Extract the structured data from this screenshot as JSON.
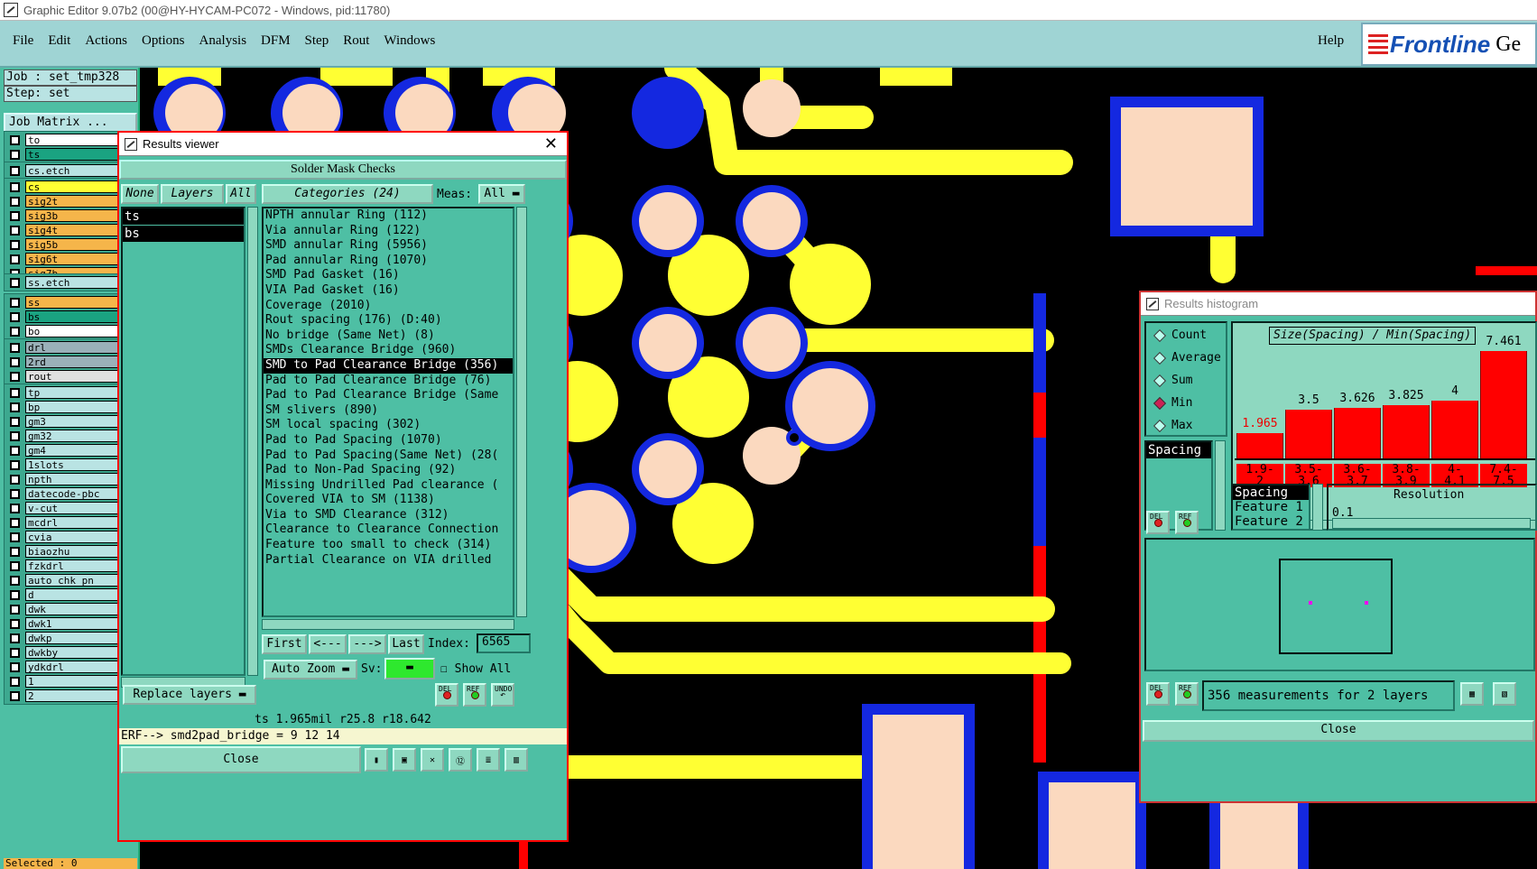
{
  "title_bar": "Graphic Editor 9.07b2 (00@HY-HYCAM-PC072 - Windows, pid:11780)",
  "menu": [
    "File",
    "Edit",
    "Actions",
    "Options",
    "Analysis",
    "DFM",
    "Step",
    "Rout",
    "Windows"
  ],
  "help": "Help",
  "logo": {
    "brand": "Frontline",
    "brand_suffix": "Ge"
  },
  "job_label": "Job : set_tmp328",
  "step_label": "Step: set",
  "job_matrix": "Job Matrix ...",
  "layers": [
    {
      "name": "to",
      "color": "#ffffff",
      "sel": true
    },
    {
      "name": "ts",
      "color": "#1aa381",
      "sel": true
    },
    {
      "name": "cs.etch",
      "color": "#b9e3e3",
      "sel": false
    },
    {
      "name": "cs",
      "color": "#ffff33",
      "sel": true
    },
    {
      "name": "sig2t",
      "color": "#f5b54a",
      "sel": false
    },
    {
      "name": "sig3b",
      "color": "#f5b54a",
      "sel": true
    },
    {
      "name": "sig4t",
      "color": "#f5b54a",
      "sel": true
    },
    {
      "name": "sig5b",
      "color": "#f5b54a",
      "sel": false
    },
    {
      "name": "sig6t",
      "color": "#f5b54a",
      "sel": false
    },
    {
      "name": "sig7b",
      "color": "#f5b54a",
      "sel": false
    },
    {
      "name": "ss.etch",
      "color": "#b9e3e3",
      "sel": false
    },
    {
      "name": "ss",
      "color": "#f5b54a",
      "sel": false
    },
    {
      "name": "bs",
      "color": "#1aa381",
      "sel": false
    },
    {
      "name": "bo",
      "color": "#ffffff",
      "sel": true
    },
    {
      "name": "drl",
      "color": "#9ab0b8",
      "sel": false
    },
    {
      "name": "2rd",
      "color": "#9ab0b8",
      "sel": false
    },
    {
      "name": "rout",
      "color": "#e0e0e0",
      "sel": false
    },
    {
      "name": "tp",
      "color": "#b9e3e3",
      "sel": true
    },
    {
      "name": "bp",
      "color": "#b9e3e3",
      "sel": false
    },
    {
      "name": "gm3",
      "color": "#b9e3e3",
      "sel": false
    },
    {
      "name": "gm32",
      "color": "#b9e3e3",
      "sel": false
    },
    {
      "name": "gm4",
      "color": "#b9e3e3",
      "sel": false
    },
    {
      "name": "1slots",
      "color": "#b9e3e3",
      "sel": false
    },
    {
      "name": "npth",
      "color": "#b9e3e3",
      "sel": false
    },
    {
      "name": "datecode-pbc",
      "color": "#b9e3e3",
      "sel": false
    },
    {
      "name": "v-cut",
      "color": "#b9e3e3",
      "sel": false
    },
    {
      "name": "mcdrl",
      "color": "#b9e3e3",
      "sel": false
    },
    {
      "name": "cvia",
      "color": "#b9e3e3",
      "sel": false
    },
    {
      "name": "biaozhu",
      "color": "#b9e3e3",
      "sel": false
    },
    {
      "name": "fzkdrl",
      "color": "#b9e3e3",
      "sel": false
    },
    {
      "name": "auto_chk_pn",
      "color": "#b9e3e3",
      "sel": false
    },
    {
      "name": "d",
      "color": "#b9e3e3",
      "sel": false
    },
    {
      "name": "dwk",
      "color": "#b9e3e3",
      "sel": false
    },
    {
      "name": "dwk1",
      "color": "#b9e3e3",
      "sel": false
    },
    {
      "name": "dwkp",
      "color": "#b9e3e3",
      "sel": false
    },
    {
      "name": "dwkby",
      "color": "#b9e3e3",
      "sel": false
    },
    {
      "name": "ydkdrl",
      "color": "#b9e3e3",
      "sel": false
    },
    {
      "name": "1",
      "color": "#b9e3e3",
      "sel": false
    },
    {
      "name": "2",
      "color": "#b9e3e3",
      "sel": false
    }
  ],
  "selected": "Selected : 0",
  "results_viewer": {
    "title": "Results viewer",
    "header": "Solder Mask Checks",
    "none": "None",
    "layers_btn": "Layers",
    "all_btn": "All",
    "categories_btn": "Categories (24)",
    "meas_label": "Meas:",
    "meas_value": "All",
    "layer_list": [
      "ts",
      "bs"
    ],
    "categories": [
      "NPTH annular Ring (112)",
      "Via annular Ring (122)",
      "SMD annular Ring (5956)",
      "Pad annular Ring (1070)",
      "SMD Pad Gasket (16)",
      "VIA Pad Gasket (16)",
      "Coverage (2010)",
      "Rout spacing (176)       (D:40)",
      "No bridge (Same Net) (8)",
      "SMDs Clearance Bridge (960)",
      "SMD to Pad Clearance Bridge (356)",
      "Pad to Pad Clearance Bridge (76)",
      "Pad to Pad Clearance Bridge (Same",
      "SM slivers (890)",
      "SM local spacing (302)",
      "Pad to Pad Spacing (1070)",
      "Pad to Pad Spacing(Same Net) (28(",
      "Pad to Non-Pad Spacing (92)",
      "Missing Undrilled Pad clearance (",
      "Covered VIA to SM (1138)",
      "Via to SMD Clearance (312)",
      "Clearance to Clearance Connection",
      "Feature too small to check (314)",
      "Partial Clearance on VIA drilled"
    ],
    "selected_category_index": 10,
    "nav": {
      "first": "First",
      "prev": "<---",
      "next": "--->",
      "last": "Last",
      "index_label": "Index:",
      "index_value": "6565"
    },
    "auto_zoom": "Auto Zoom",
    "sv_label": "Sv:",
    "show_all": "Show All",
    "replace_layers": "Replace layers",
    "del": "DEL",
    "ref": "REF",
    "undo": "UNDO",
    "status": "ts 1.965mil  r25.8  r18.642",
    "erf": "ERF--> smd2pad_bridge = 9 12 14",
    "close": "Close"
  },
  "histogram": {
    "title": "Results histogram",
    "modes": [
      {
        "label": "Count",
        "on": false
      },
      {
        "label": "Average",
        "on": false
      },
      {
        "label": "Sum",
        "on": false
      },
      {
        "label": "Min",
        "on": true
      },
      {
        "label": "Max",
        "on": false
      }
    ],
    "chart_title": "Size(Spacing) / Min(Spacing)",
    "bars": [
      {
        "value": "1.965",
        "bin": [
          "1.9-",
          "2"
        ],
        "level": 0.22,
        "red": true
      },
      {
        "value": "3.5",
        "bin": [
          "3.5-",
          "3.6"
        ],
        "level": 0.42,
        "red": false
      },
      {
        "value": "3.626",
        "bin": [
          "3.6-",
          "3.7"
        ],
        "level": 0.44,
        "red": false
      },
      {
        "value": "3.825",
        "bin": [
          "3.8-",
          "3.9"
        ],
        "level": 0.46,
        "red": false
      },
      {
        "value": "4",
        "bin": [
          "4-",
          "4.1"
        ],
        "level": 0.5,
        "red": false
      },
      {
        "value": "7.461",
        "bin": [
          "7.4-",
          "7.5"
        ],
        "level": 0.93,
        "red": false
      }
    ],
    "attr_list": [
      "Spacing"
    ],
    "feature_list": [
      "Spacing",
      "Feature 1",
      "Feature 2"
    ],
    "resolution_label": "Resolution",
    "resolution_value": "0.1",
    "measurements": "356 measurements for 2 layers",
    "del": "DEL",
    "ref": "REF",
    "close": "Close"
  }
}
